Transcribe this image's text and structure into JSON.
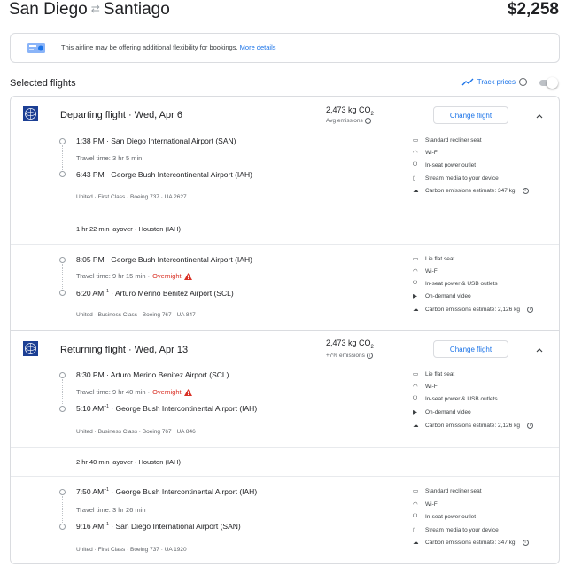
{
  "header": {
    "origin": "San Diego",
    "destination": "Santiago",
    "price": "$2,258"
  },
  "banner": {
    "text": "This airline may be offering additional flexibility for bookings.",
    "link": "More details"
  },
  "selected": {
    "title": "Selected flights",
    "track_label": "Track prices",
    "info": "i"
  },
  "departing": {
    "heading": "Departing flight · Wed, Apr 6",
    "co2": "2,473 kg CO",
    "co2_sub": "2",
    "co2_sub_label": "Avg emissions",
    "change_label": "Change flight",
    "seg1": {
      "dep_time": "1:38 PM",
      "dep_airport": "San Diego International Airport (SAN)",
      "travel": "Travel time: 3 hr 5 min",
      "arr_time": "6:43 PM",
      "arr_airport": "George Bush Intercontinental Airport (IAH)",
      "meta": "United · First Class · Boeing 737 · UA 2627",
      "amenities": [
        "Standard recliner seat",
        "Wi-Fi",
        "In-seat power outlet",
        "Stream media to your device",
        "Carbon emissions estimate: 347 kg"
      ]
    },
    "layover": "1 hr 22 min layover · Houston (IAH)",
    "seg2": {
      "dep_time": "8:05 PM",
      "dep_airport": "George Bush Intercontinental Airport (IAH)",
      "travel": "Travel time: 9 hr 15 min · ",
      "overnight": "Overnight",
      "arr_time": "6:20 AM",
      "arr_plus": "+1",
      "arr_airport": "Arturo Merino Benitez Airport (SCL)",
      "meta": "United · Business Class · Boeing 767 · UA 847",
      "amenities": [
        "Lie flat seat",
        "Wi-Fi",
        "In-seat power & USB outlets",
        "On-demand video",
        "Carbon emissions estimate: 2,126 kg"
      ]
    }
  },
  "returning": {
    "heading": "Returning flight · Wed, Apr 13",
    "co2": "2,473 kg CO",
    "co2_sub": "2",
    "co2_sub_label": "+7% emissions",
    "change_label": "Change flight",
    "seg1": {
      "dep_time": "8:30 PM",
      "dep_airport": "Arturo Merino Benitez Airport (SCL)",
      "travel": "Travel time: 9 hr 40 min · ",
      "overnight": "Overnight",
      "arr_time": "5:10 AM",
      "arr_plus": "+1",
      "arr_airport": "George Bush Intercontinental Airport (IAH)",
      "meta": "United · Business Class · Boeing 767 · UA 846",
      "amenities": [
        "Lie flat seat",
        "Wi-Fi",
        "In-seat power & USB outlets",
        "On-demand video",
        "Carbon emissions estimate: 2,126 kg"
      ]
    },
    "layover": "2 hr 40 min layover · Houston (IAH)",
    "seg2": {
      "dep_time": "7:50 AM",
      "dep_plus": "+1",
      "dep_airport": "George Bush Intercontinental Airport (IAH)",
      "travel": "Travel time: 3 hr 26 min",
      "arr_time": "9:16 AM",
      "arr_plus": "+1",
      "arr_airport": "San Diego International Airport (SAN)",
      "meta": "United · First Class · Boeing 737 · UA 1920",
      "amenities": [
        "Standard recliner seat",
        "Wi-Fi",
        "In-seat power outlet",
        "Stream media to your device",
        "Carbon emissions estimate: 347 kg"
      ]
    }
  },
  "colors": {
    "accent": "#1a73e8",
    "warning": "#d93025",
    "border": "#dadce0",
    "muted": "#5f6368"
  }
}
